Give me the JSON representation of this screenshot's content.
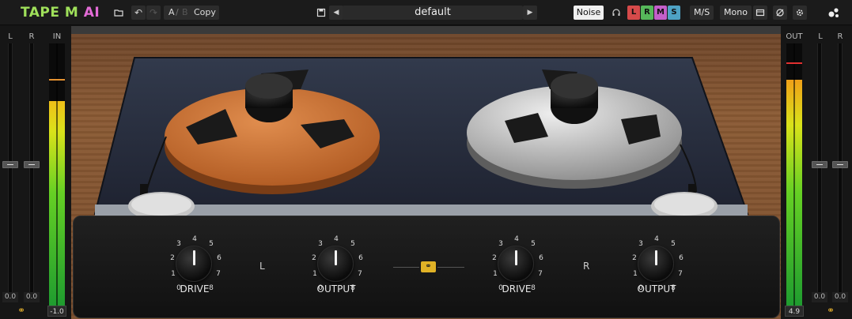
{
  "app": {
    "title_part1": "TAPE M",
    "title_part2": "AI"
  },
  "toolbar": {
    "ab_a": "A",
    "ab_sep": "/",
    "ab_b": "B",
    "copy_label": "Copy",
    "preset_name": "default",
    "noise_label": "Noise",
    "ch_l": "L",
    "ch_r": "R",
    "ch_m": "M",
    "ch_s": "S",
    "ms_label": "M/S",
    "mono_label": "Mono"
  },
  "icons": {
    "folder": "folder-icon",
    "undo": "undo-icon",
    "redo": "redo-icon",
    "save": "save-icon",
    "prev": "prev-preset-icon",
    "next": "next-preset-icon",
    "headphones": "headphones-icon",
    "window": "window-icon",
    "bypass": "bypass-icon",
    "settings": "gear-icon",
    "logo": "brand-logo-icon"
  },
  "colors": {
    "accent_link": "#d8a72c",
    "ch_l": "#d64a4a",
    "ch_r": "#56b85a",
    "ch_m": "#c35fc9",
    "ch_s": "#4ea2c4"
  },
  "left_meters": {
    "label_l": "L",
    "label_r": "R",
    "label_in": "IN",
    "value_l": "0.0",
    "value_r": "0.0",
    "value_in": "-1.0",
    "in_level_fraction": 0.78
  },
  "right_meters": {
    "label_out": "OUT",
    "label_l": "L",
    "label_r": "R",
    "value_out": "4.9",
    "value_l": "0.0",
    "value_r": "0.0",
    "out_level_fraction": 0.86
  },
  "controls": {
    "left_channel_label": "L",
    "right_channel_label": "R",
    "ticks": [
      "0",
      "1",
      "2",
      "3",
      "4",
      "5",
      "6",
      "7",
      "8"
    ],
    "knobs": [
      {
        "name": "DRIVE",
        "value": 4
      },
      {
        "name": "OUTPUT",
        "value": 4
      },
      {
        "name": "DRIVE",
        "value": 4
      },
      {
        "name": "OUTPUT",
        "value": 4
      }
    ]
  }
}
